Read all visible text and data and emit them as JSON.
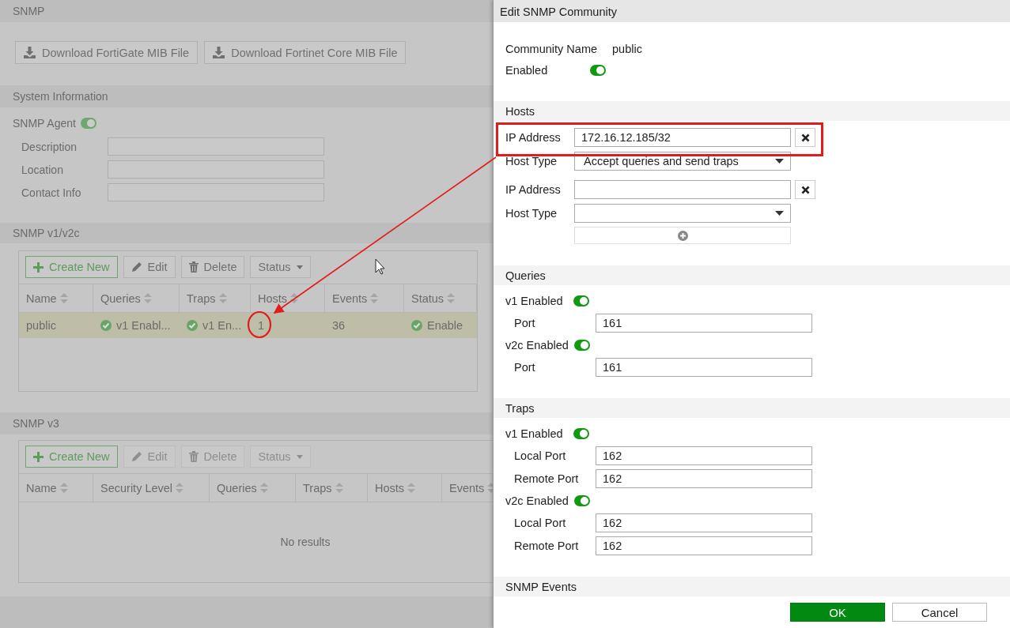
{
  "page": {
    "title": "SNMP",
    "downloads": [
      {
        "label": "Download FortiGate MIB File"
      },
      {
        "label": "Download Fortinet Core MIB File"
      }
    ],
    "system_information": {
      "title": "System Information",
      "agent": {
        "label": "SNMP Agent",
        "on": true
      },
      "fields": [
        {
          "label": "Description"
        },
        {
          "label": "Location"
        },
        {
          "label": "Contact Info"
        }
      ]
    },
    "v1v2c": {
      "title": "SNMP v1/v2c",
      "toolbar": [
        {
          "kind": "create",
          "label": "Create New",
          "disabled": false
        },
        {
          "kind": "edit",
          "label": "Edit",
          "disabled": false
        },
        {
          "kind": "delete",
          "label": "Delete",
          "disabled": false
        },
        {
          "kind": "dropdown",
          "label": "Status",
          "disabled": false
        }
      ],
      "columns": [
        "Name",
        "Queries",
        "Traps",
        "Hosts",
        "Events",
        "Status"
      ],
      "rows": [
        {
          "selected": true,
          "cells": [
            {
              "text": "public",
              "check": false
            },
            {
              "text": "v1 Enabl...",
              "check": true
            },
            {
              "text": "v1 En...",
              "check": true
            },
            {
              "text": "1",
              "check": false
            },
            {
              "text": "36",
              "check": false
            },
            {
              "text": "Enable",
              "check": true
            }
          ]
        }
      ]
    },
    "v3": {
      "title": "SNMP v3",
      "toolbar": [
        {
          "kind": "create",
          "label": "Create New",
          "disabled": false
        },
        {
          "kind": "edit",
          "label": "Edit",
          "disabled": true
        },
        {
          "kind": "delete",
          "label": "Delete",
          "disabled": true
        },
        {
          "kind": "dropdown",
          "label": "Status",
          "disabled": true
        }
      ],
      "columns": [
        "Name",
        "Security Level",
        "Queries",
        "Traps",
        "Hosts",
        "Events"
      ],
      "empty": "No results"
    }
  },
  "dialog": {
    "title": "Edit SNMP Community",
    "community_name": {
      "label": "Community Name",
      "value": "public"
    },
    "enabled": {
      "label": "Enabled",
      "on": true
    },
    "hosts": {
      "title": "Hosts",
      "items": [
        {
          "ip_label": "IP Address",
          "ip": "172.16.12.185/32",
          "type_label": "Host Type",
          "type": "Accept queries and send traps"
        },
        {
          "ip_label": "IP Address",
          "type_label": "Host Type"
        }
      ]
    },
    "queries": {
      "title": "Queries",
      "items": [
        {
          "label": "v1 Enabled",
          "on": true,
          "ports": [
            {
              "label": "Port",
              "value": "161"
            }
          ]
        },
        {
          "label": "v2c Enabled",
          "on": true,
          "ports": [
            {
              "label": "Port",
              "value": "161"
            }
          ]
        }
      ]
    },
    "traps": {
      "title": "Traps",
      "items": [
        {
          "label": "v1 Enabled",
          "on": true,
          "ports": [
            {
              "label": "Local Port",
              "value": "162"
            },
            {
              "label": "Remote Port",
              "value": "162"
            }
          ]
        },
        {
          "label": "v2c Enabled",
          "on": true,
          "ports": [
            {
              "label": "Local Port",
              "value": "162"
            },
            {
              "label": "Remote Port",
              "value": "162"
            }
          ]
        }
      ]
    },
    "next_section": "SNMP Events",
    "buttons": [
      {
        "kind": "primary",
        "label": "OK"
      },
      {
        "kind": "secondary",
        "label": "Cancel"
      }
    ]
  },
  "annotations": [
    {
      "kind": "rectangle"
    },
    {
      "kind": "arrow"
    },
    {
      "kind": "circle"
    },
    {
      "kind": "cursor"
    }
  ]
}
